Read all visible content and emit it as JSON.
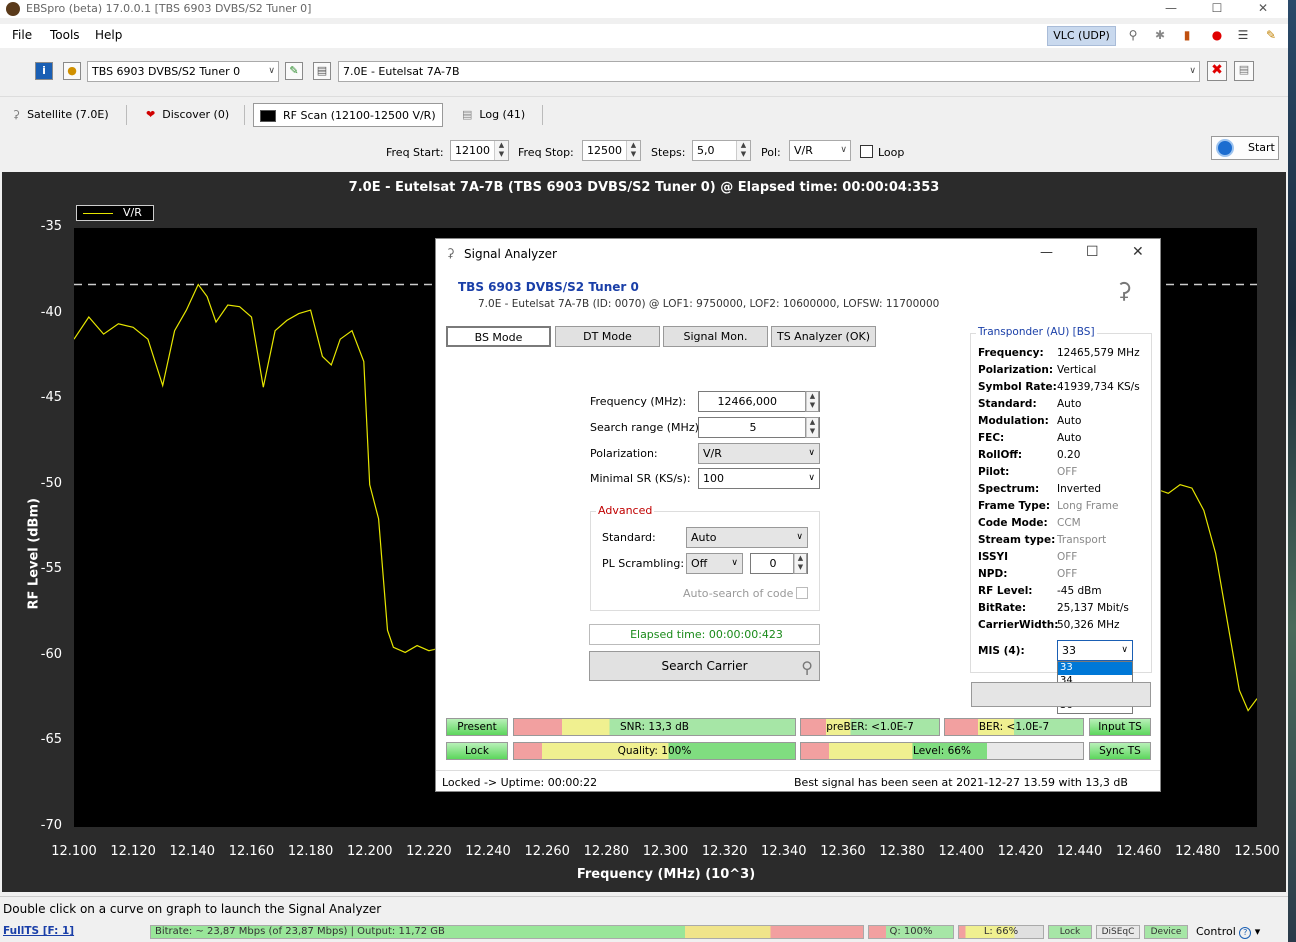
{
  "window": {
    "title": "EBSpro (beta) 17.0.0.1 [TBS 6903 DVBS/S2 Tuner 0]",
    "min": "—",
    "max": "☐",
    "close": "✕"
  },
  "menu": {
    "file": "File",
    "tools": "Tools",
    "help": "Help",
    "vlc": "VLC (UDP)"
  },
  "toolbar": {
    "tuner": "TBS 6903 DVBS/S2 Tuner 0",
    "satellite": "7.0E - Eutelsat 7A-7B"
  },
  "tabs": [
    {
      "label": "Satellite (7.0E)"
    },
    {
      "label": "Discover (0)"
    },
    {
      "label": "RF Scan (12100-12500 V/R)"
    },
    {
      "label": "Log (41)"
    }
  ],
  "scan": {
    "freq_start_label": "Freq Start:",
    "freq_start": "12100",
    "freq_stop_label": "Freq Stop:",
    "freq_stop": "12500",
    "steps_label": "Steps:",
    "steps": "5,0",
    "pol_label": "Pol:",
    "pol": "V/R",
    "loop_label": "Loop",
    "start_label": "Start"
  },
  "chart_data": {
    "type": "line",
    "title": "7.0E - Eutelsat 7A-7B (TBS 6903 DVBS/S2 Tuner 0) @ Elapsed time: 00:00:04:353",
    "xlabel": "Frequency (MHz) (10^3)",
    "ylabel": "RF Level (dBm)",
    "xlim": [
      12.1,
      12.5
    ],
    "ylim": [
      -70,
      -35
    ],
    "x_ticks": [
      "12.100",
      "12.120",
      "12.140",
      "12.160",
      "12.180",
      "12.200",
      "12.220",
      "12.240",
      "12.260",
      "12.280",
      "12.300",
      "12.320",
      "12.340",
      "12.360",
      "12.380",
      "12.400",
      "12.420",
      "12.440",
      "12.460",
      "12.480",
      "12.500"
    ],
    "y_ticks": [
      "-35",
      "-40",
      "-45",
      "-50",
      "-55",
      "-60",
      "-65",
      "-70"
    ],
    "threshold": -38.3,
    "legend": "V/R",
    "series": [
      {
        "name": "V/R",
        "color": "#e6e600",
        "x": [
          12.1,
          12.105,
          12.11,
          12.115,
          12.12,
          12.125,
          12.13,
          12.134,
          12.138,
          12.142,
          12.145,
          12.148,
          12.152,
          12.156,
          12.16,
          12.164,
          12.168,
          12.172,
          12.176,
          12.18,
          12.184,
          12.187,
          12.19,
          12.194,
          12.198,
          12.2,
          12.203,
          12.206,
          12.208,
          12.212,
          12.216,
          12.22,
          12.45,
          12.455,
          12.46,
          12.465,
          12.47,
          12.474,
          12.478,
          12.482,
          12.486,
          12.49,
          12.494,
          12.497,
          12.5
        ],
        "y": [
          -41.5,
          -40.2,
          -41.2,
          -40.6,
          -40.8,
          -41.5,
          -44.2,
          -41.0,
          -39.8,
          -38.3,
          -39.0,
          -40.5,
          -39.5,
          -39.6,
          -40.2,
          -44.3,
          -41.0,
          -40.4,
          -40.0,
          -39.8,
          -42.5,
          -43.0,
          -41.5,
          -41.0,
          -42.8,
          -50.0,
          -52.0,
          -58.5,
          -59.5,
          -59.8,
          -59.4,
          -59.7,
          -50.3,
          -50.4,
          -50.3,
          -50.2,
          -50.5,
          -50.0,
          -50.2,
          -51.5,
          -54.0,
          -58.0,
          -62.0,
          -63.2,
          -62.5
        ]
      }
    ]
  },
  "analyzer": {
    "title": "Signal Analyzer",
    "device": "TBS 6903 DVBS/S2 Tuner 0",
    "subtitle": "7.0E - Eutelsat 7A-7B (ID: 0070) @ LOF1: 9750000, LOF2: 10600000, LOFSW: 11700000",
    "modes": [
      "BS Mode",
      "DT Mode",
      "Signal Mon.",
      "TS Analyzer (OK)"
    ],
    "freq_label": "Frequency (MHz):",
    "freq": "12466,000",
    "range_label": "Search range (MHz):",
    "range": "5",
    "pol_label": "Polarization:",
    "pol": "V/R",
    "minsr_label": "Minimal SR (KS/s):",
    "minsr": "100",
    "advanced": "Advanced",
    "standard_label": "Standard:",
    "standard": "Auto",
    "pls_label": "PL Scrambling:",
    "pls": "Off",
    "pls_code": "0",
    "autosearch": "Auto-search of code",
    "elapsed": "Elapsed time: 00:00:00:423",
    "search_btn": "Search Carrier",
    "transponder_title": "Transponder (AU) [BS]",
    "tp": [
      {
        "k": "Frequency:",
        "v": "12465,579 MHz",
        "dim": false
      },
      {
        "k": "Polarization:",
        "v": "Vertical",
        "dim": false
      },
      {
        "k": "Symbol Rate:",
        "v": "41939,734 KS/s",
        "dim": false
      },
      {
        "k": "Standard:",
        "v": "Auto",
        "dim": false
      },
      {
        "k": "Modulation:",
        "v": "Auto",
        "dim": false
      },
      {
        "k": "FEC:",
        "v": "Auto",
        "dim": false
      },
      {
        "k": "RollOff:",
        "v": "0.20",
        "dim": false
      },
      {
        "k": "Pilot:",
        "v": "OFF",
        "dim": true
      },
      {
        "k": "Spectrum:",
        "v": "Inverted",
        "dim": false
      },
      {
        "k": "Frame Type:",
        "v": "Long Frame",
        "dim": true
      },
      {
        "k": "Code Mode:",
        "v": "CCM",
        "dim": true
      },
      {
        "k": "Stream type:",
        "v": "Transport",
        "dim": true
      },
      {
        "k": "ISSYI",
        "v": "OFF",
        "dim": true
      },
      {
        "k": "NPD:",
        "v": "OFF",
        "dim": true
      },
      {
        "k": "RF Level:",
        "v": "-45 dBm",
        "dim": false
      },
      {
        "k": "BitRate:",
        "v": "25,137 Mbit/s",
        "dim": false
      },
      {
        "k": "CarrierWidth:",
        "v": "50,326 MHz",
        "dim": false
      }
    ],
    "mis_label": "MIS (4):",
    "mis": "33",
    "mis_options": [
      "33",
      "34",
      "35",
      "36"
    ],
    "present": "Present",
    "lock": "Lock",
    "snr": "SNR: 13,3 dB",
    "quality": "Quality: 100%",
    "quality_pct": 100,
    "preber": "preBER: <1.0E-7",
    "level": "Level: 66%",
    "level_pct": 66,
    "ber": "BER: <1.0E-7",
    "input_ts": "Input TS",
    "sync_ts": "Sync TS",
    "status_left": "Locked -> Uptime: 00:00:22",
    "status_right": "Best signal has been seen at 2021-12-27 13.59 with 13,3 dB"
  },
  "statusbar": {
    "hint": "Double click on a curve on graph to launch the Signal Analyzer",
    "fullts": "FullTS [F: 1]",
    "bitrate": "Bitrate: ~ 23,87 Mbps (of 23,87 Mbps) | Output: 11,72 GB",
    "q": "Q: 100%",
    "l": "L: 66%",
    "lock": "Lock",
    "diseqc": "DiSEqC",
    "device": "Device",
    "control": "Control"
  }
}
